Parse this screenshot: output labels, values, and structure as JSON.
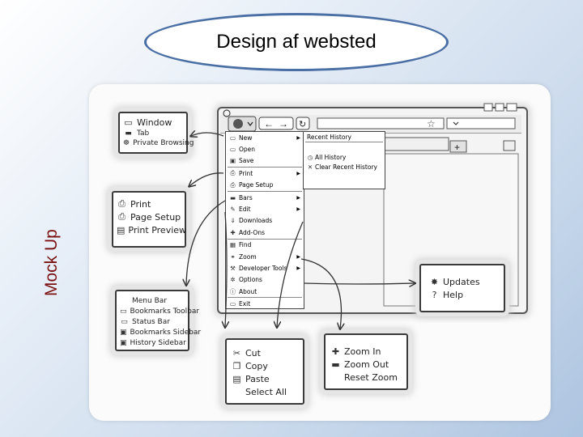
{
  "title": "Design af websted",
  "side_label": "Mock Up",
  "menus": {
    "window": {
      "items": [
        {
          "icon": "window-icon",
          "glyph": "▭",
          "label": "Window"
        },
        {
          "icon": "tab-icon",
          "glyph": "▬",
          "label": "Tab"
        },
        {
          "icon": "private-browsing-icon",
          "glyph": "☸",
          "label": "Private Browsing"
        }
      ]
    },
    "print": {
      "items": [
        {
          "icon": "printer-icon",
          "glyph": "⎙",
          "label": "Print"
        },
        {
          "icon": "page-setup-icon",
          "glyph": "⎙",
          "label": "Page Setup"
        },
        {
          "icon": "print-preview-icon",
          "glyph": "▤",
          "label": "Print Preview"
        }
      ]
    },
    "bars": {
      "items": [
        {
          "icon": "menu-bar-icon",
          "glyph": "",
          "label": "Menu Bar"
        },
        {
          "icon": "bookmarks-toolbar-icon",
          "glyph": "▭",
          "label": "Bookmarks Toolbar"
        },
        {
          "icon": "status-bar-icon",
          "glyph": "▭",
          "label": "Status Bar"
        },
        {
          "icon": "bookmarks-sidebar-icon",
          "glyph": "▣",
          "label": "Bookmarks Sidebar"
        },
        {
          "icon": "history-sidebar-icon",
          "glyph": "▣",
          "label": "History Sidebar"
        }
      ]
    },
    "edit": {
      "items": [
        {
          "icon": "scissors-icon",
          "glyph": "✂",
          "label": "Cut"
        },
        {
          "icon": "copy-icon",
          "glyph": "❐",
          "label": "Copy"
        },
        {
          "icon": "paste-icon",
          "glyph": "▤",
          "label": "Paste"
        },
        {
          "icon": "select-all-icon",
          "glyph": "",
          "label": "Select All"
        }
      ]
    },
    "zoom": {
      "items": [
        {
          "icon": "plus-icon",
          "glyph": "✚",
          "label": "Zoom In"
        },
        {
          "icon": "minus-icon",
          "glyph": "▬",
          "label": "Zoom Out"
        },
        {
          "icon": "reset-zoom-icon",
          "glyph": "",
          "label": "Reset Zoom"
        }
      ]
    },
    "help": {
      "items": [
        {
          "icon": "updates-icon",
          "glyph": "✸",
          "label": "Updates"
        },
        {
          "icon": "help-icon",
          "glyph": "?",
          "label": "Help"
        }
      ]
    },
    "main": {
      "items": [
        {
          "icon": "new-icon",
          "glyph": "▭",
          "label": "New",
          "arrow": true
        },
        {
          "icon": "open-icon",
          "glyph": "▭",
          "label": "Open"
        },
        {
          "icon": "save-icon",
          "glyph": "▣",
          "label": "Save",
          "sep": true
        },
        {
          "icon": "print-icon",
          "glyph": "⎙",
          "label": "Print",
          "arrow": true
        },
        {
          "icon": "page-setup-icon",
          "glyph": "⎙",
          "label": "Page Setup",
          "sep": true
        },
        {
          "icon": "bars-icon",
          "glyph": "▬",
          "label": "Bars",
          "arrow": true
        },
        {
          "icon": "edit-icon",
          "glyph": "✎",
          "label": "Edit",
          "arrow": true
        },
        {
          "icon": "downloads-icon",
          "glyph": "⇓",
          "label": "Downloads"
        },
        {
          "icon": "add-ons-icon",
          "glyph": "✚",
          "label": "Add-Ons",
          "sep": true
        },
        {
          "icon": "find-icon",
          "glyph": "▦",
          "label": "Find"
        },
        {
          "icon": "zoom-icon",
          "glyph": "⚭",
          "label": "Zoom",
          "arrow": true
        },
        {
          "icon": "developer-tools-icon",
          "glyph": "⚒",
          "label": "Developer Tools",
          "arrow": true
        },
        {
          "icon": "options-icon",
          "glyph": "✲",
          "label": "Options"
        },
        {
          "icon": "about-icon",
          "glyph": "ⓘ",
          "label": "About",
          "sep": true
        },
        {
          "icon": "exit-icon",
          "glyph": "▭",
          "label": "Exit"
        }
      ]
    },
    "history": {
      "items": [
        {
          "icon": "",
          "glyph": "",
          "label": "Recent History",
          "sep": true
        },
        {
          "icon": "",
          "glyph": "",
          "label": ""
        },
        {
          "icon": "clock-icon",
          "glyph": "◷",
          "label": "All History"
        },
        {
          "icon": "clear-icon",
          "glyph": "✕",
          "label": "Clear Recent History"
        }
      ]
    }
  }
}
